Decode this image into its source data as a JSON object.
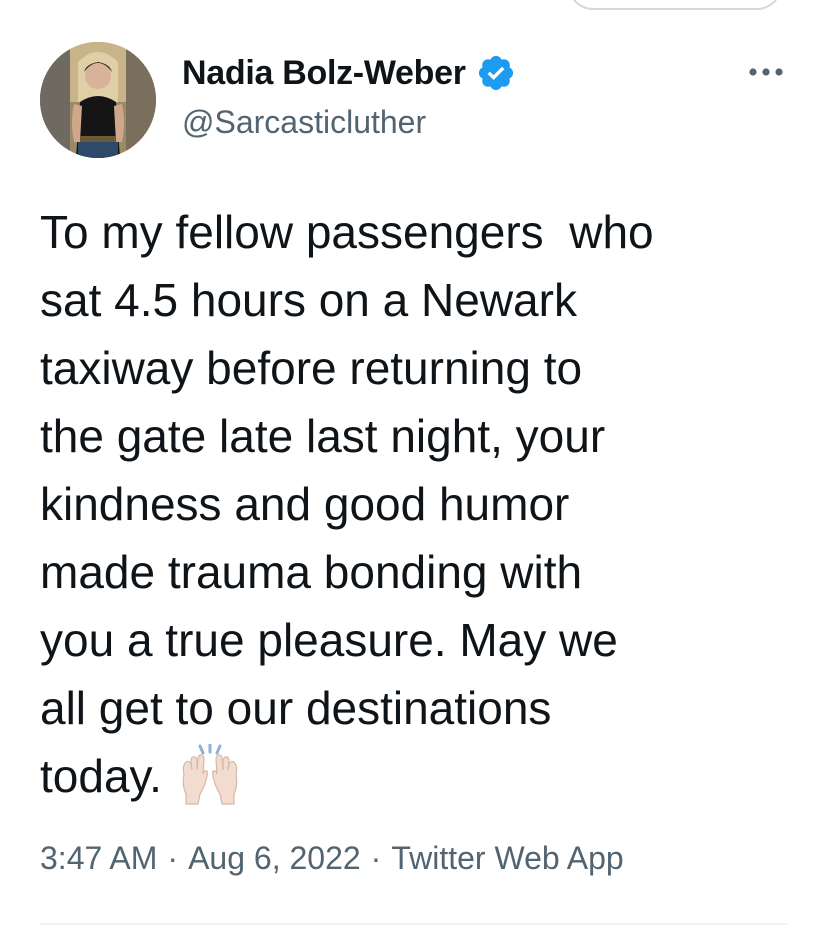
{
  "tweet": {
    "author": {
      "display_name": "Nadia Bolz-Weber",
      "handle": "@Sarcasticluther",
      "verified": true,
      "verified_color": "#1d9bf0"
    },
    "lines": [
      "To my fellow passengers  who",
      "sat 4.5 hours on a Newark",
      "taxiway before returning to",
      "the gate late last night, your",
      "kindness and good humor",
      "made trauma bonding with",
      "you a true pleasure. May we",
      "all get to our destinations",
      "today."
    ],
    "emoji": "raising-hands-icon",
    "time": "3:47 AM",
    "separator": "·",
    "date": "Aug 6, 2022",
    "source": "Twitter Web App"
  },
  "icons": {
    "more": "more-options-icon",
    "verified": "verified-badge-icon"
  },
  "colors": {
    "text": "#0f1419",
    "secondary": "#536471",
    "divider": "#eff3f4"
  }
}
